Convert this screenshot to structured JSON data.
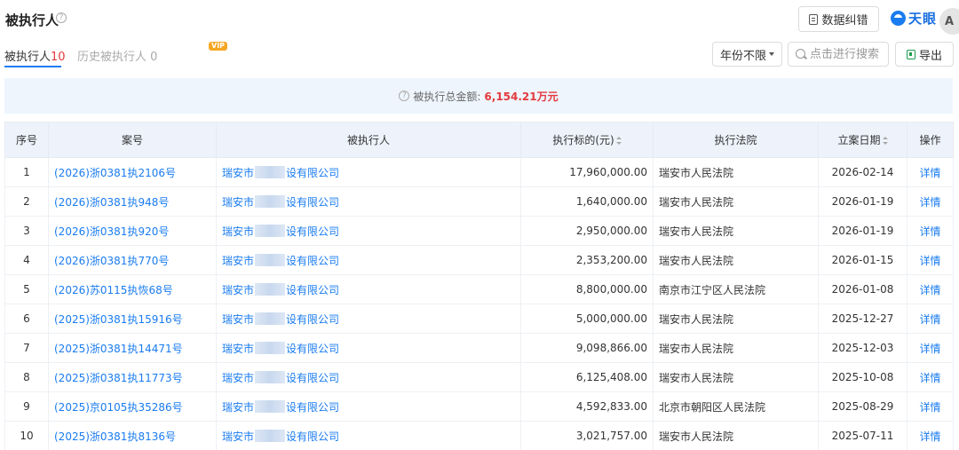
{
  "header": {
    "title": "被执行人",
    "correct_label": "数据纠错",
    "logo_text": "天眼",
    "corner_label": "A"
  },
  "tabs": [
    {
      "label": "被执行人",
      "count": "10"
    },
    {
      "label": "历史被执行人",
      "count": "0",
      "badge": "VIP"
    }
  ],
  "filters": {
    "year_label": "年份不限",
    "search_placeholder": "点击进行搜索",
    "export_label": "导出"
  },
  "summary": {
    "label": "被执行总金额:",
    "value": "6,154.21万元"
  },
  "table": {
    "columns": [
      "序号",
      "案号",
      "被执行人",
      "执行标的(元)",
      "执行法院",
      "立案日期",
      "操作"
    ],
    "rows": [
      {
        "idx": "1",
        "case": "(2026)浙0381执2106号",
        "party_prefix": "瑞安市",
        "party_suffix": "设有限公司",
        "amount": "17,960,000.00",
        "court": "瑞安市人民法院",
        "date": "2026-02-14",
        "action": "详情"
      },
      {
        "idx": "2",
        "case": "(2026)浙0381执948号",
        "party_prefix": "瑞安市",
        "party_suffix": "设有限公司",
        "amount": "1,640,000.00",
        "court": "瑞安市人民法院",
        "date": "2026-01-19",
        "action": "详情"
      },
      {
        "idx": "3",
        "case": "(2026)浙0381执920号",
        "party_prefix": "瑞安市",
        "party_suffix": "设有限公司",
        "amount": "2,950,000.00",
        "court": "瑞安市人民法院",
        "date": "2026-01-19",
        "action": "详情"
      },
      {
        "idx": "4",
        "case": "(2026)浙0381执770号",
        "party_prefix": "瑞安市",
        "party_suffix": "设有限公司",
        "amount": "2,353,200.00",
        "court": "瑞安市人民法院",
        "date": "2026-01-15",
        "action": "详情"
      },
      {
        "idx": "5",
        "case": "(2026)苏0115执恢68号",
        "party_prefix": "瑞安市",
        "party_suffix": "设有限公司",
        "amount": "8,800,000.00",
        "court": "南京市江宁区人民法院",
        "date": "2026-01-08",
        "action": "详情"
      },
      {
        "idx": "6",
        "case": "(2025)浙0381执15916号",
        "party_prefix": "瑞安市",
        "party_suffix": "设有限公司",
        "amount": "5,000,000.00",
        "court": "瑞安市人民法院",
        "date": "2025-12-27",
        "action": "详情"
      },
      {
        "idx": "7",
        "case": "(2025)浙0381执14471号",
        "party_prefix": "瑞安市",
        "party_suffix": "设有限公司",
        "amount": "9,098,866.00",
        "court": "瑞安市人民法院",
        "date": "2025-12-03",
        "action": "详情"
      },
      {
        "idx": "8",
        "case": "(2025)浙0381执11773号",
        "party_prefix": "瑞安市",
        "party_suffix": "设有限公司",
        "amount": "6,125,408.00",
        "court": "瑞安市人民法院",
        "date": "2025-10-08",
        "action": "详情"
      },
      {
        "idx": "9",
        "case": "(2025)京0105执35286号",
        "party_prefix": "瑞安市",
        "party_suffix": "设有限公司",
        "amount": "4,592,833.00",
        "court": "北京市朝阳区人民法院",
        "date": "2025-08-29",
        "action": "详情"
      },
      {
        "idx": "10",
        "case": "(2025)浙0381执8136号",
        "party_prefix": "瑞安市",
        "party_suffix": "设有限公司",
        "amount": "3,021,757.00",
        "court": "瑞安市人民法院",
        "date": "2025-07-11",
        "action": "详情"
      }
    ]
  },
  "colors": {
    "accent": "#1a7cf0",
    "highlight": "#e4393c",
    "summary_bg": "#eef5fd",
    "header_bg": "#eef3fb"
  }
}
